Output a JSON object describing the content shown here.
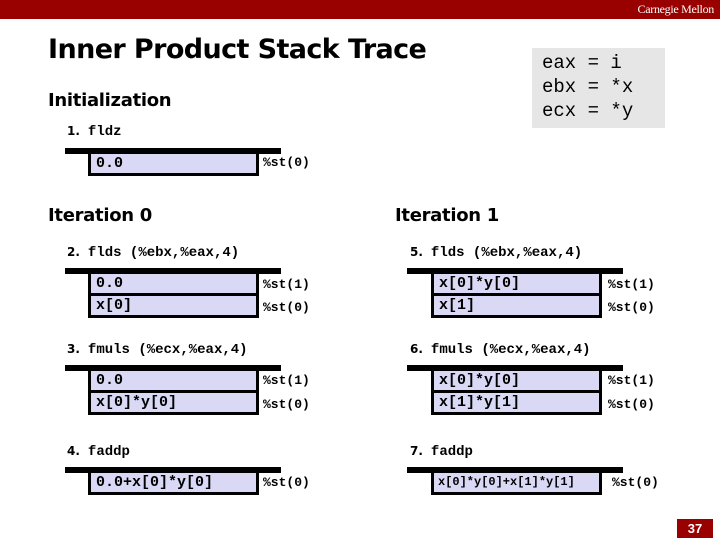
{
  "header": {
    "brand": "Carnegie Mellon"
  },
  "title": "Inner Product Stack Trace",
  "registers": [
    "eax = i",
    "ebx = *x",
    "ecx = *y"
  ],
  "sections": {
    "init": "Initialization",
    "iter0": "Iteration 0",
    "iter1": "Iteration 1"
  },
  "steps": [
    {
      "num": "1.",
      "instr": "fldz",
      "cells": [
        "0.0"
      ],
      "labels": [
        "%st(0)"
      ]
    },
    {
      "num": "2.",
      "instr": "flds (%ebx,%eax,4)",
      "cells": [
        "0.0",
        "x[0]"
      ],
      "labels": [
        "%st(1)",
        "%st(0)"
      ]
    },
    {
      "num": "3.",
      "instr": "fmuls (%ecx,%eax,4)",
      "cells": [
        "0.0",
        "x[0]*y[0]"
      ],
      "labels": [
        "%st(1)",
        "%st(0)"
      ]
    },
    {
      "num": "4.",
      "instr": "faddp",
      "cells": [
        "0.0+x[0]*y[0]"
      ],
      "labels": [
        "%st(0)"
      ]
    },
    {
      "num": "5.",
      "instr": "flds (%ebx,%eax,4)",
      "cells": [
        "x[0]*y[0]",
        "x[1]"
      ],
      "labels": [
        "%st(1)",
        "%st(0)"
      ]
    },
    {
      "num": "6.",
      "instr": "fmuls (%ecx,%eax,4)",
      "cells": [
        "x[0]*y[0]",
        "x[1]*y[1]"
      ],
      "labels": [
        "%st(1)",
        "%st(0)"
      ]
    },
    {
      "num": "7.",
      "instr": "faddp",
      "cells": [
        "x[0]*y[0]+x[1]*y[1]"
      ],
      "labels": [
        "%st(0)"
      ]
    }
  ],
  "page_number": "37",
  "colors": {
    "brand": "#990000",
    "stack_cell": "#d9d9f5",
    "register_box": "#e6e6e6"
  }
}
